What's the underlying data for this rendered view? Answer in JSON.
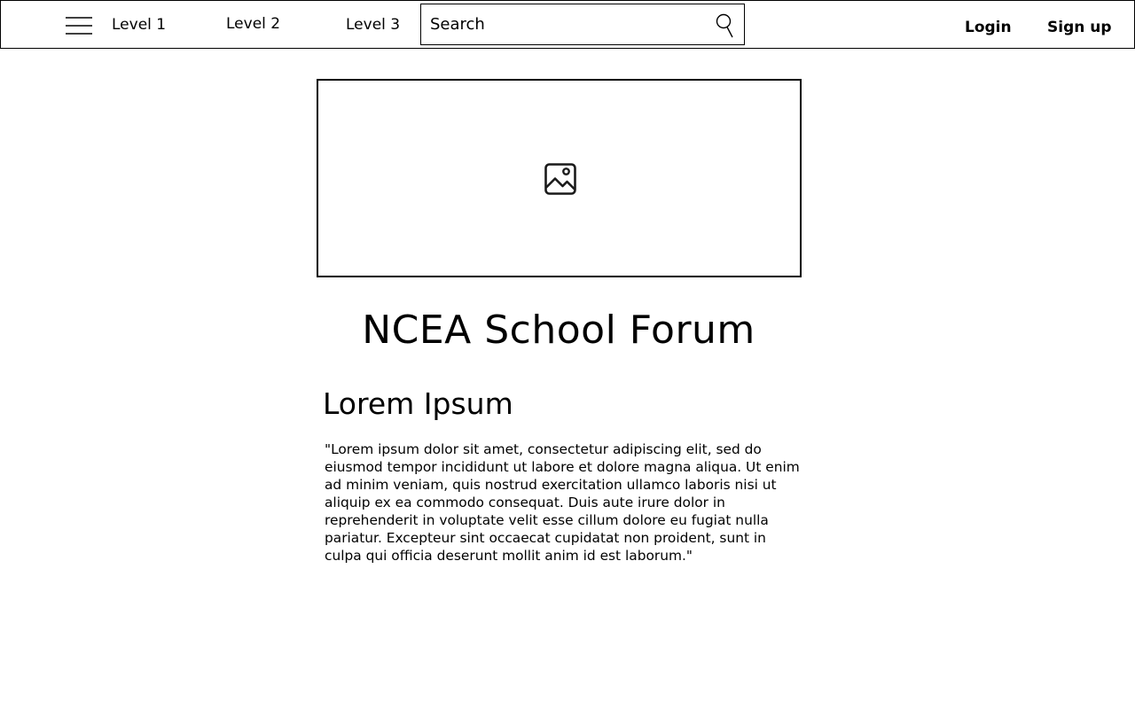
{
  "header": {
    "nav_links": [
      "Level 1",
      "Level 2",
      "Level 3"
    ],
    "search": {
      "placeholder": "Search",
      "value": ""
    },
    "login_label": "Login",
    "signup_label": "Sign up"
  },
  "hero": {
    "icon": "image-icon"
  },
  "main": {
    "title": "NCEA School Forum",
    "section_heading": "Lorem Ipsum",
    "body_text": "\"Lorem ipsum dolor sit amet, consectetur adipiscing elit, sed do eiusmod tempor incididunt ut labore et dolore magna aliqua. Ut enim ad minim veniam, quis nostrud exercitation ullamco laboris nisi ut aliquip ex ea commodo consequat. Duis aute irure dolor in reprehenderit in voluptate velit esse cillum dolore eu fugiat nulla pariatur. Excepteur sint occaecat cupidatat non proident, sunt in culpa qui officia deserunt mollit anim id est laborum.\""
  },
  "colors": {
    "background": "#ffffff",
    "foreground": "#000000",
    "border": "#000000"
  },
  "icons": [
    "hamburger-menu-icon",
    "search-icon",
    "image-icon"
  ]
}
